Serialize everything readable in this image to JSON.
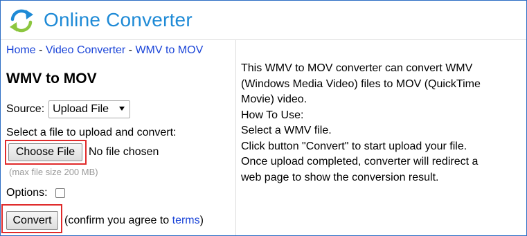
{
  "app": {
    "logo_text": "Online Converter",
    "brand_color": "#1e8ad6",
    "link_color": "#1a44d8",
    "highlight_color": "#e02a2a"
  },
  "breadcrumb": {
    "items": [
      "Home",
      "Video Converter",
      "WMV to MOV"
    ],
    "separator": " - "
  },
  "form": {
    "title": "WMV to MOV",
    "source_label": "Source:",
    "source_selected": "Upload File",
    "upload_label": "Select a file to upload and convert:",
    "choose_file_label": "Choose File",
    "no_file_text": "No file chosen",
    "max_size_text": "(max file size 200 MB)",
    "options_label": "Options:",
    "options_checked": false,
    "convert_label": "Convert",
    "confirm_prefix": "(confirm you agree to ",
    "terms_link": "terms",
    "confirm_suffix": ")"
  },
  "description": {
    "lines": [
      "This WMV to MOV converter can convert WMV",
      "(Windows Media Video) files to MOV (QuickTime",
      "Movie) video.",
      "How To Use:",
      "Select a WMV file.",
      "Click button \"Convert\" to start upload your file.",
      "Once upload completed, converter will redirect a",
      "web page to show the conversion result."
    ]
  }
}
